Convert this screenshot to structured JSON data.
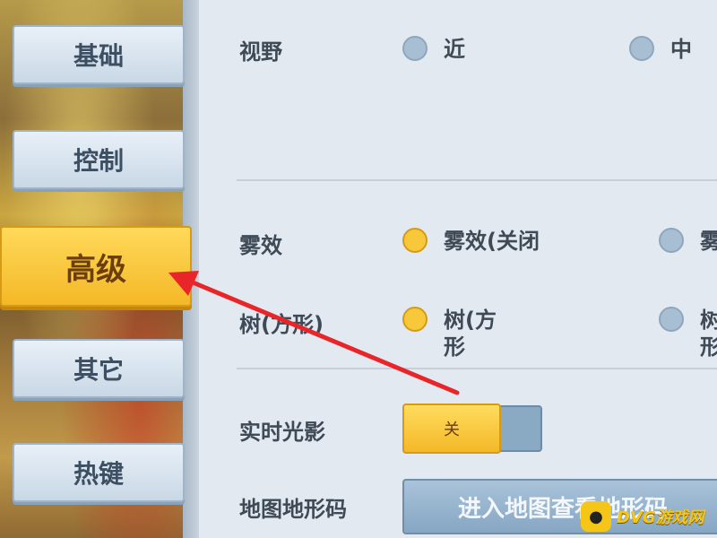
{
  "sidebar": {
    "tabs": [
      {
        "label": "基础",
        "active": false
      },
      {
        "label": "控制",
        "active": false
      },
      {
        "label": "高级",
        "active": true
      },
      {
        "label": "其它",
        "active": false
      },
      {
        "label": "热键",
        "active": false
      }
    ]
  },
  "settings": {
    "view": {
      "label": "视野",
      "options": [
        {
          "label": "近",
          "selected": false
        },
        {
          "label": "中",
          "selected": false
        }
      ]
    },
    "fog": {
      "label": "雾效",
      "options": [
        {
          "label": "雾效(关闭",
          "selected": true
        },
        {
          "label": "雾",
          "selected": false
        }
      ]
    },
    "tree": {
      "label": "树(方形)",
      "options": [
        {
          "label": "树(方形",
          "selected": true
        },
        {
          "label": "树形",
          "selected": false
        }
      ]
    },
    "realtime_shadow": {
      "label": "实时光影",
      "toggle_label": "关"
    },
    "terrain_code": {
      "label": "地图地形码",
      "button_label": "进入地图查看地形码"
    }
  },
  "colors": {
    "accent": "#f4b827",
    "panel": "#e3e9f0",
    "radio_off": "#a8bed3",
    "arrow": "#e8262a"
  },
  "watermark": {
    "badge_icon": "gamepad-icon",
    "text": "DVG游戏网"
  }
}
